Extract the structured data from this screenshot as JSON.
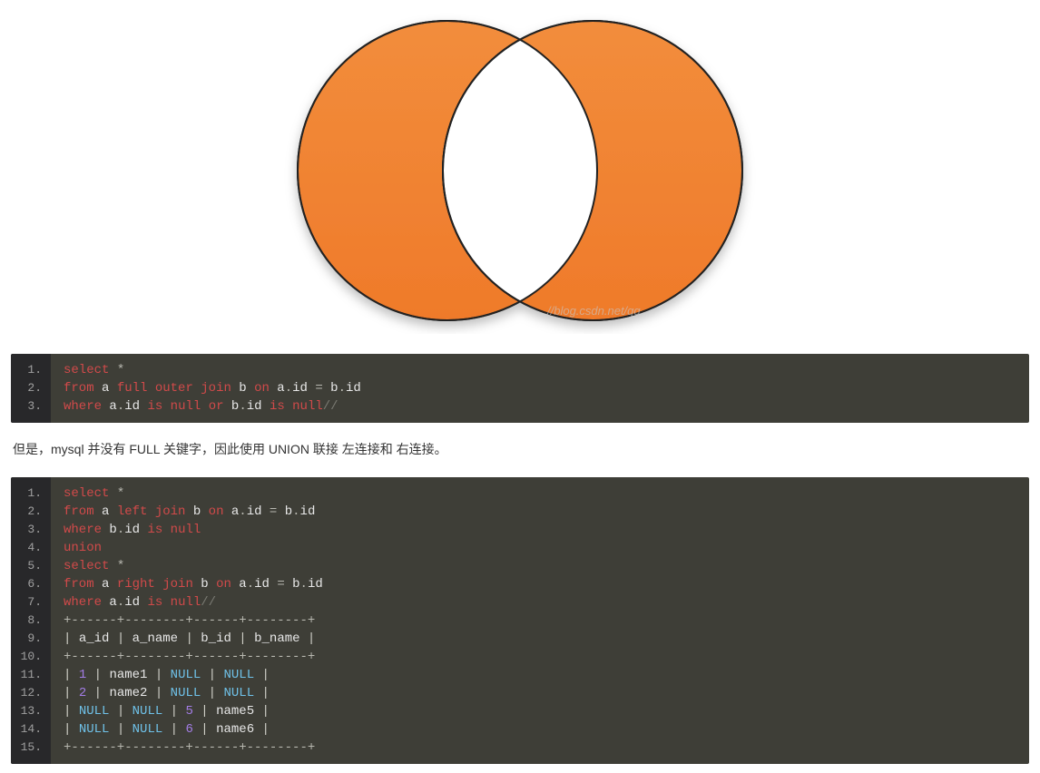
{
  "venn": {
    "watermark": "//blog.csdn.net/qq",
    "fill": "#ef7a2a",
    "fill_top": "#f28d3c",
    "stroke": "#222222"
  },
  "code1": {
    "lines": [
      [
        {
          "c": "kw",
          "t": "select"
        },
        {
          "c": "op",
          "t": " *"
        }
      ],
      [
        {
          "c": "kw",
          "t": "from"
        },
        {
          "c": "id",
          "t": " a "
        },
        {
          "c": "kw",
          "t": "full"
        },
        {
          "c": "id",
          "t": " "
        },
        {
          "c": "kw",
          "t": "outer"
        },
        {
          "c": "id",
          "t": " "
        },
        {
          "c": "kw",
          "t": "join"
        },
        {
          "c": "id",
          "t": " b "
        },
        {
          "c": "kw",
          "t": "on"
        },
        {
          "c": "id",
          "t": " a"
        },
        {
          "c": "op",
          "t": "."
        },
        {
          "c": "id",
          "t": "id "
        },
        {
          "c": "op",
          "t": "="
        },
        {
          "c": "id",
          "t": " b"
        },
        {
          "c": "op",
          "t": "."
        },
        {
          "c": "id",
          "t": "id"
        }
      ],
      [
        {
          "c": "kw",
          "t": "where"
        },
        {
          "c": "id",
          "t": " a"
        },
        {
          "c": "op",
          "t": "."
        },
        {
          "c": "id",
          "t": "id "
        },
        {
          "c": "kw",
          "t": "is"
        },
        {
          "c": "id",
          "t": " "
        },
        {
          "c": "kw",
          "t": "null"
        },
        {
          "c": "id",
          "t": " "
        },
        {
          "c": "kw",
          "t": "or"
        },
        {
          "c": "id",
          "t": " b"
        },
        {
          "c": "op",
          "t": "."
        },
        {
          "c": "id",
          "t": "id "
        },
        {
          "c": "kw",
          "t": "is"
        },
        {
          "c": "id",
          "t": " "
        },
        {
          "c": "kw",
          "t": "null"
        },
        {
          "c": "cmt",
          "t": "//"
        }
      ]
    ]
  },
  "paragraph": "但是，mysql 并没有 FULL 关键字，因此使用 UNION 联接 左连接和 右连接。",
  "code2": {
    "lines": [
      [
        {
          "c": "kw",
          "t": "select"
        },
        {
          "c": "op",
          "t": " *"
        }
      ],
      [
        {
          "c": "kw",
          "t": "from"
        },
        {
          "c": "id",
          "t": " a "
        },
        {
          "c": "kw",
          "t": "left"
        },
        {
          "c": "id",
          "t": " "
        },
        {
          "c": "kw",
          "t": "join"
        },
        {
          "c": "id",
          "t": " b "
        },
        {
          "c": "kw",
          "t": "on"
        },
        {
          "c": "id",
          "t": " a"
        },
        {
          "c": "op",
          "t": "."
        },
        {
          "c": "id",
          "t": "id "
        },
        {
          "c": "op",
          "t": "="
        },
        {
          "c": "id",
          "t": " b"
        },
        {
          "c": "op",
          "t": "."
        },
        {
          "c": "id",
          "t": "id"
        }
      ],
      [
        {
          "c": "kw",
          "t": "where"
        },
        {
          "c": "id",
          "t": " b"
        },
        {
          "c": "op",
          "t": "."
        },
        {
          "c": "id",
          "t": "id "
        },
        {
          "c": "kw",
          "t": "is"
        },
        {
          "c": "id",
          "t": " "
        },
        {
          "c": "kw",
          "t": "null"
        }
      ],
      [
        {
          "c": "kw",
          "t": "union"
        }
      ],
      [
        {
          "c": "kw",
          "t": "select"
        },
        {
          "c": "op",
          "t": " *"
        }
      ],
      [
        {
          "c": "kw",
          "t": "from"
        },
        {
          "c": "id",
          "t": " a "
        },
        {
          "c": "kw",
          "t": "right"
        },
        {
          "c": "id",
          "t": " "
        },
        {
          "c": "kw",
          "t": "join"
        },
        {
          "c": "id",
          "t": " b "
        },
        {
          "c": "kw",
          "t": "on"
        },
        {
          "c": "id",
          "t": " a"
        },
        {
          "c": "op",
          "t": "."
        },
        {
          "c": "id",
          "t": "id "
        },
        {
          "c": "op",
          "t": "="
        },
        {
          "c": "id",
          "t": " b"
        },
        {
          "c": "op",
          "t": "."
        },
        {
          "c": "id",
          "t": "id"
        }
      ],
      [
        {
          "c": "kw",
          "t": "where"
        },
        {
          "c": "id",
          "t": " a"
        },
        {
          "c": "op",
          "t": "."
        },
        {
          "c": "id",
          "t": "id "
        },
        {
          "c": "kw",
          "t": "is"
        },
        {
          "c": "id",
          "t": " "
        },
        {
          "c": "kw",
          "t": "null"
        },
        {
          "c": "cmt",
          "t": "//"
        }
      ],
      [
        {
          "c": "op",
          "t": "+------+--------+------+--------+"
        }
      ],
      [
        {
          "c": "pipe",
          "t": "| "
        },
        {
          "c": "id",
          "t": "a_id"
        },
        {
          "c": "pipe",
          "t": " | "
        },
        {
          "c": "id",
          "t": "a_name"
        },
        {
          "c": "pipe",
          "t": " | "
        },
        {
          "c": "id",
          "t": "b_id"
        },
        {
          "c": "pipe",
          "t": " | "
        },
        {
          "c": "id",
          "t": "b_name"
        },
        {
          "c": "pipe",
          "t": " |"
        }
      ],
      [
        {
          "c": "op",
          "t": "+------+--------+------+--------+"
        }
      ],
      [
        {
          "c": "pipe",
          "t": "| "
        },
        {
          "c": "num",
          "t": "1"
        },
        {
          "c": "pipe",
          "t": " | "
        },
        {
          "c": "id",
          "t": "name1"
        },
        {
          "c": "pipe",
          "t": " | "
        },
        {
          "c": "nul",
          "t": "NULL"
        },
        {
          "c": "pipe",
          "t": " | "
        },
        {
          "c": "nul",
          "t": "NULL"
        },
        {
          "c": "pipe",
          "t": " |"
        }
      ],
      [
        {
          "c": "pipe",
          "t": "| "
        },
        {
          "c": "num",
          "t": "2"
        },
        {
          "c": "pipe",
          "t": " | "
        },
        {
          "c": "id",
          "t": "name2"
        },
        {
          "c": "pipe",
          "t": " | "
        },
        {
          "c": "nul",
          "t": "NULL"
        },
        {
          "c": "pipe",
          "t": " | "
        },
        {
          "c": "nul",
          "t": "NULL"
        },
        {
          "c": "pipe",
          "t": " |"
        }
      ],
      [
        {
          "c": "pipe",
          "t": "| "
        },
        {
          "c": "nul",
          "t": "NULL"
        },
        {
          "c": "pipe",
          "t": " | "
        },
        {
          "c": "nul",
          "t": "NULL"
        },
        {
          "c": "pipe",
          "t": " | "
        },
        {
          "c": "num",
          "t": "5"
        },
        {
          "c": "pipe",
          "t": " | "
        },
        {
          "c": "id",
          "t": "name5"
        },
        {
          "c": "pipe",
          "t": " |"
        }
      ],
      [
        {
          "c": "pipe",
          "t": "| "
        },
        {
          "c": "nul",
          "t": "NULL"
        },
        {
          "c": "pipe",
          "t": " | "
        },
        {
          "c": "nul",
          "t": "NULL"
        },
        {
          "c": "pipe",
          "t": " | "
        },
        {
          "c": "num",
          "t": "6"
        },
        {
          "c": "pipe",
          "t": " | "
        },
        {
          "c": "id",
          "t": "name6"
        },
        {
          "c": "pipe",
          "t": " |"
        }
      ],
      [
        {
          "c": "op",
          "t": "+------+--------+------+--------+"
        }
      ]
    ]
  }
}
